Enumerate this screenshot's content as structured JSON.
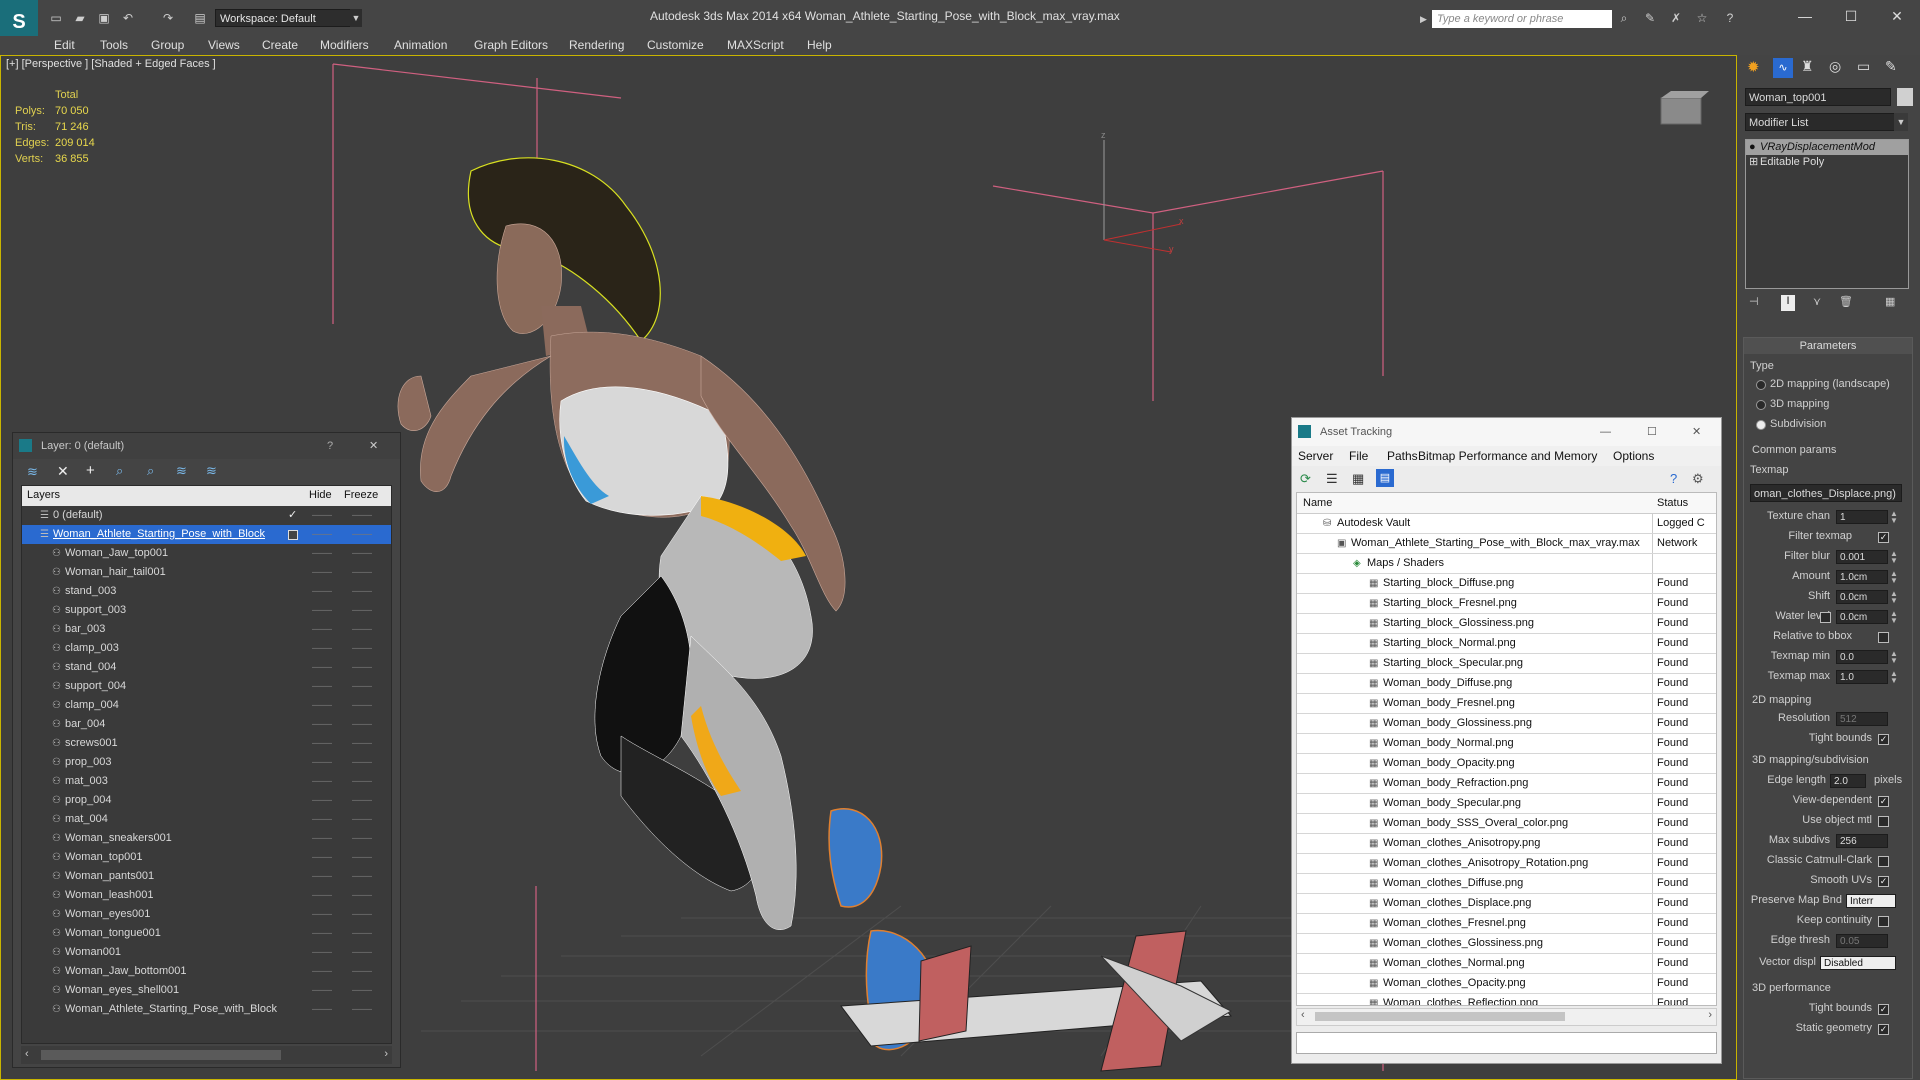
{
  "app": {
    "title": "Autodesk 3ds Max  2014 x64      Woman_Athlete_Starting_Pose_with_Block_max_vray.max",
    "workspace": "Workspace: Default",
    "search_placeholder": "Type a keyword or phrase"
  },
  "menu": [
    "Edit",
    "Tools",
    "Group",
    "Views",
    "Create",
    "Modifiers",
    "Animation",
    "Graph Editors",
    "Rendering",
    "Customize",
    "MAXScript",
    "Help"
  ],
  "viewport": {
    "label": "[+] [Perspective ] [Shaded + Edged Faces ]",
    "stats_header": "Total",
    "stats": [
      {
        "key": "Polys:",
        "value": "70 050"
      },
      {
        "key": "Tris:",
        "value": "71 246"
      },
      {
        "key": "Edges:",
        "value": "209 014"
      },
      {
        "key": "Verts:",
        "value": "36 855"
      }
    ],
    "gizmo": {
      "z": "z",
      "x": "x",
      "y": "y"
    }
  },
  "layer_panel": {
    "title": "Layer: 0 (default)",
    "help": "?",
    "close": "✕",
    "columns": {
      "layers": "Layers",
      "hide": "Hide",
      "freeze": "Freeze"
    },
    "rows": [
      {
        "name": "0 (default)",
        "level": 0,
        "check": "✓"
      },
      {
        "name": "Woman_Athlete_Starting_Pose_with_Block",
        "level": 0,
        "selected": true
      },
      {
        "name": "Woman_Jaw_top001",
        "level": 1
      },
      {
        "name": "Woman_hair_tail001",
        "level": 1
      },
      {
        "name": "stand_003",
        "level": 1
      },
      {
        "name": "support_003",
        "level": 1
      },
      {
        "name": "bar_003",
        "level": 1
      },
      {
        "name": "clamp_003",
        "level": 1
      },
      {
        "name": "stand_004",
        "level": 1
      },
      {
        "name": "support_004",
        "level": 1
      },
      {
        "name": "clamp_004",
        "level": 1
      },
      {
        "name": "bar_004",
        "level": 1
      },
      {
        "name": "screws001",
        "level": 1
      },
      {
        "name": "prop_003",
        "level": 1
      },
      {
        "name": "mat_003",
        "level": 1
      },
      {
        "name": "prop_004",
        "level": 1
      },
      {
        "name": "mat_004",
        "level": 1
      },
      {
        "name": "Woman_sneakers001",
        "level": 1
      },
      {
        "name": "Woman_top001",
        "level": 1
      },
      {
        "name": "Woman_pants001",
        "level": 1
      },
      {
        "name": "Woman_leash001",
        "level": 1
      },
      {
        "name": "Woman_eyes001",
        "level": 1
      },
      {
        "name": "Woman_tongue001",
        "level": 1
      },
      {
        "name": "Woman001",
        "level": 1
      },
      {
        "name": "Woman_Jaw_bottom001",
        "level": 1
      },
      {
        "name": "Woman_eyes_shell001",
        "level": 1
      },
      {
        "name": "Woman_Athlete_Starting_Pose_with_Block",
        "level": 1
      }
    ]
  },
  "asset_panel": {
    "title": "Asset Tracking",
    "menu": [
      "Server",
      "File",
      "Paths",
      "Bitmap Performance and Memory",
      "Options"
    ],
    "columns": {
      "name": "Name",
      "status": "Status"
    },
    "rows": [
      {
        "name": "Autodesk Vault",
        "status": "Logged C",
        "level": 0
      },
      {
        "name": "Woman_Athlete_Starting_Pose_with_Block_max_vray.max",
        "status": "Network",
        "level": 1
      },
      {
        "name": "Maps / Shaders",
        "status": "",
        "level": 2
      },
      {
        "name": "Starting_block_Diffuse.png",
        "status": "Found",
        "level": 3
      },
      {
        "name": "Starting_block_Fresnel.png",
        "status": "Found",
        "level": 3
      },
      {
        "name": "Starting_block_Glossiness.png",
        "status": "Found",
        "level": 3
      },
      {
        "name": "Starting_block_Normal.png",
        "status": "Found",
        "level": 3
      },
      {
        "name": "Starting_block_Specular.png",
        "status": "Found",
        "level": 3
      },
      {
        "name": "Woman_body_Diffuse.png",
        "status": "Found",
        "level": 3
      },
      {
        "name": "Woman_body_Fresnel.png",
        "status": "Found",
        "level": 3
      },
      {
        "name": "Woman_body_Glossiness.png",
        "status": "Found",
        "level": 3
      },
      {
        "name": "Woman_body_Normal.png",
        "status": "Found",
        "level": 3
      },
      {
        "name": "Woman_body_Opacity.png",
        "status": "Found",
        "level": 3
      },
      {
        "name": "Woman_body_Refraction.png",
        "status": "Found",
        "level": 3
      },
      {
        "name": "Woman_body_Specular.png",
        "status": "Found",
        "level": 3
      },
      {
        "name": "Woman_body_SSS_Overal_color.png",
        "status": "Found",
        "level": 3
      },
      {
        "name": "Woman_clothes_Anisotropy.png",
        "status": "Found",
        "level": 3
      },
      {
        "name": "Woman_clothes_Anisotropy_Rotation.png",
        "status": "Found",
        "level": 3
      },
      {
        "name": "Woman_clothes_Diffuse.png",
        "status": "Found",
        "level": 3
      },
      {
        "name": "Woman_clothes_Displace.png",
        "status": "Found",
        "level": 3
      },
      {
        "name": "Woman_clothes_Fresnel.png",
        "status": "Found",
        "level": 3
      },
      {
        "name": "Woman_clothes_Glossiness.png",
        "status": "Found",
        "level": 3
      },
      {
        "name": "Woman_clothes_Normal.png",
        "status": "Found",
        "level": 3
      },
      {
        "name": "Woman_clothes_Opacity.png",
        "status": "Found",
        "level": 3
      },
      {
        "name": "Woman_clothes_Reflection.png",
        "status": "Found",
        "level": 3
      }
    ]
  },
  "command_panel": {
    "object_name": "Woman_top001",
    "modifier_list": "Modifier List",
    "stack": [
      "VRayDisplacementMod",
      "Editable Poly"
    ],
    "rollout": "Parameters",
    "type_label": "Type",
    "type_options": [
      {
        "label": "2D mapping (landscape)",
        "on": false
      },
      {
        "label": "3D mapping",
        "on": false
      },
      {
        "label": "Subdivision",
        "on": true
      }
    ],
    "common_params": "Common params",
    "texmap_label": "Texmap",
    "texmap_value": "oman_clothes_Displace.png)",
    "fields": [
      {
        "label": "Texture chan",
        "value": "1"
      },
      {
        "label": "Filter texmap",
        "check": "✓"
      },
      {
        "label": "Filter blur",
        "value": "0.001"
      },
      {
        "label": "Amount",
        "value": "1.0cm"
      },
      {
        "label": "Shift",
        "value": "0.0cm"
      },
      {
        "label": "Water level",
        "value": "0.0cm",
        "check": ""
      },
      {
        "label": "Relative to bbox",
        "check": ""
      },
      {
        "label": "Texmap min",
        "value": "0.0"
      },
      {
        "label": "Texmap max",
        "value": "1.0"
      }
    ],
    "mapping2d": "2D mapping",
    "resolution_label": "Resolution",
    "resolution_value": "512",
    "tight_bounds_label": "Tight bounds",
    "mapping3d": "3D mapping/subdivision",
    "edge_length_label": "Edge length",
    "edge_length_value": "2.0",
    "pixels_label": "pixels",
    "checks3d": [
      {
        "label": "View-dependent",
        "check": "✓"
      },
      {
        "label": "Use object mtl",
        "check": ""
      }
    ],
    "max_subdivs_label": "Max subdivs",
    "max_subdivs_value": "256",
    "checks3d_b": [
      {
        "label": "Classic Catmull-Clark",
        "check": ""
      },
      {
        "label": "Smooth UVs",
        "check": "✓"
      }
    ],
    "preserve_label": "Preserve Map Bnd",
    "preserve_value": "Interr",
    "keep_continuity_label": "Keep continuity",
    "edge_thresh_label": "Edge thresh",
    "edge_thresh_value": "0.05",
    "vector_disp_label": "Vector displ",
    "vector_disp_value": "Disabled",
    "perf_title": "3D performance",
    "perf_checks": [
      {
        "label": "Tight bounds",
        "check": "✓"
      },
      {
        "label": "Static geometry",
        "check": "✓"
      }
    ]
  }
}
